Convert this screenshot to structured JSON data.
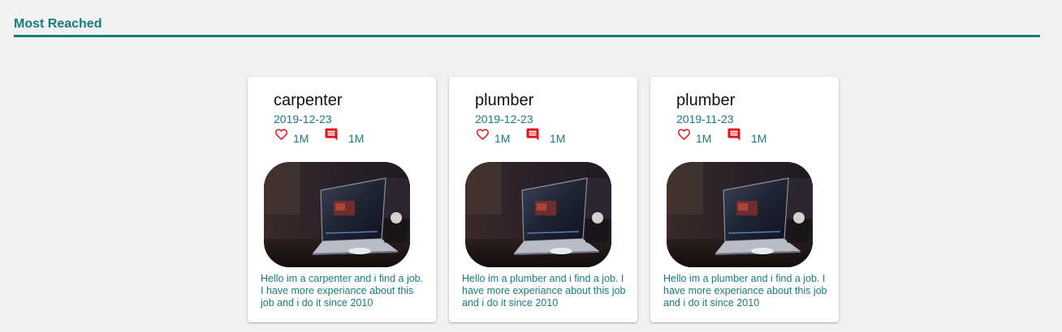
{
  "section": {
    "title": "Most Reached"
  },
  "cards": [
    {
      "title": "carpenter",
      "date": "2019-12-23",
      "likes": "1M",
      "comments": "1M",
      "description": "Hello im a carpenter and i find a job. I have more experiance about this job and i do it since 2010"
    },
    {
      "title": "plumber",
      "date": "2019-12-23",
      "likes": "1M",
      "comments": "1M",
      "description": "Hello im a plumber and i find a job. I have more experiance about this job and i do it since 2010"
    },
    {
      "title": "plumber",
      "date": "2019-11-23",
      "likes": "1M",
      "comments": "1M",
      "description": "Hello im a plumber and i find a job. I have more experiance about this job and i do it since 2010"
    }
  ],
  "icons": {
    "like": "heart-outline-icon",
    "comment": "comment-icon"
  },
  "colors": {
    "accent": "#167d7f",
    "icon_red": "#e8111a",
    "card_bg": "#ffffff",
    "page_bg": "#f1f1f1"
  }
}
